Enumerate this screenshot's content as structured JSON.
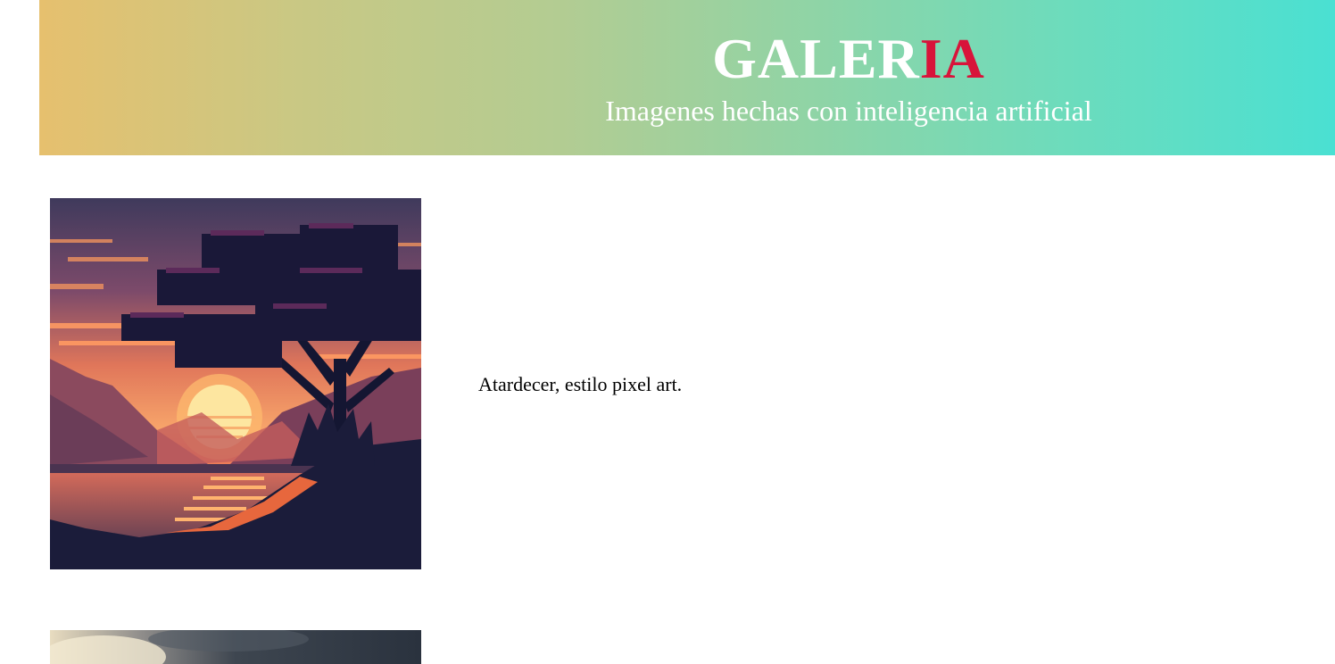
{
  "header": {
    "title_main": "GALER",
    "title_accent": "IA",
    "subtitle": "Imagenes hechas con inteligencia artificial",
    "colors": {
      "gradient_start": "#e6c06e",
      "gradient_end": "#4ae0d2",
      "accent": "#d8143a"
    }
  },
  "gallery": {
    "items": [
      {
        "image": "pixel-art-sunset-tree",
        "caption": "Atardecer, estilo pixel art."
      },
      {
        "image": "cloudy-sky-partial",
        "caption": ""
      }
    ]
  }
}
